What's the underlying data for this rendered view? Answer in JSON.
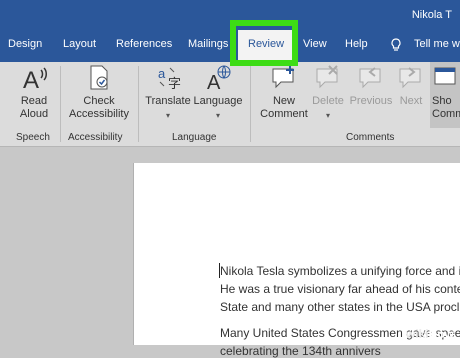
{
  "title_bar": {
    "user": "Nikola T"
  },
  "tabs": [
    {
      "label": "Design"
    },
    {
      "label": "Layout"
    },
    {
      "label": "References"
    },
    {
      "label": "Mailings"
    },
    {
      "label": "Review",
      "active": true
    },
    {
      "label": "View"
    },
    {
      "label": "Help"
    },
    {
      "label": "Tell me w"
    }
  ],
  "ribbon": {
    "speech": {
      "read_aloud": [
        "Read",
        "Aloud"
      ],
      "group": "Speech"
    },
    "accessibility": {
      "check": [
        "Check",
        "Accessibility"
      ],
      "group": "Accessibility"
    },
    "language": {
      "translate": "Translate",
      "language": "Language",
      "group": "Language"
    },
    "comments": {
      "new": [
        "New",
        "Comment"
      ],
      "delete": "Delete",
      "previous": "Previous",
      "next": "Next",
      "show": [
        "Sho",
        "Comm"
      ],
      "group": "Comments"
    }
  },
  "document": {
    "lines": [
      "Nikola Tesla symbolizes a unifying force and i",
      "He was a true visionary far ahead of his conte",
      "State and many other states in the USA procl",
      "Many United States Congressmen gave speec",
      "celebrating the 134th annivers"
    ]
  },
  "watermark": {
    "wiki": "wiki",
    "how": "How"
  },
  "colors": {
    "ribbon_blue": "#2b579a",
    "highlight_green": "#3ddc15"
  }
}
